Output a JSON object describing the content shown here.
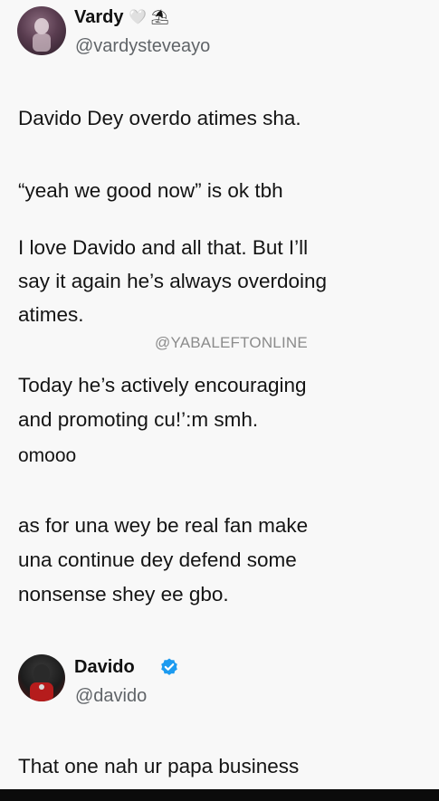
{
  "tweet1": {
    "name": "Vardy",
    "handle": "@vardysteveayo",
    "name_emojis": "🤍 ⛱",
    "lines": [
      "Davido Dey overdo atimes sha.",
      "“yeah we good now” is ok tbh",
      "I love Davido and all that. But I’ll",
      "say it again he’s always overdoing",
      "atimes.",
      "Today he’s actively encouraging",
      "and promoting cu!’:m smh.",
      "omooo",
      "as for una wey be real fan make",
      "una continue dey defend some",
      "nonsense shey ee gbo."
    ]
  },
  "watermark": "@YABALEFTONLINE",
  "tweet2": {
    "name": "Davido",
    "handle": "@davido",
    "text": "That one  nah ur papa business"
  },
  "colors": {
    "verified": "#1d9bf0",
    "background": "#f7f7f7"
  }
}
